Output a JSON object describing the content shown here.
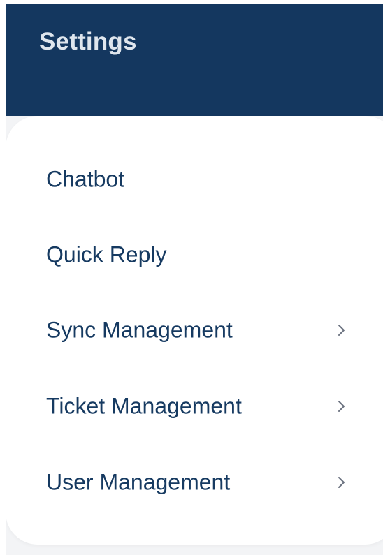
{
  "header": {
    "title": "Settings",
    "background_color": "#14375f"
  },
  "menu": {
    "items": [
      {
        "label": "Chatbot",
        "has_submenu": false
      },
      {
        "label": "Quick Reply",
        "has_submenu": false
      },
      {
        "label": "Sync Management",
        "has_submenu": true,
        "icon": "chevron-right-icon"
      },
      {
        "label": "Ticket Management",
        "has_submenu": true,
        "icon": "chevron-right-icon"
      },
      {
        "label": "User Management",
        "has_submenu": true,
        "icon": "chevron-right-icon"
      }
    ],
    "text_color": "#163a61",
    "chevron_color": "#6b7280"
  }
}
